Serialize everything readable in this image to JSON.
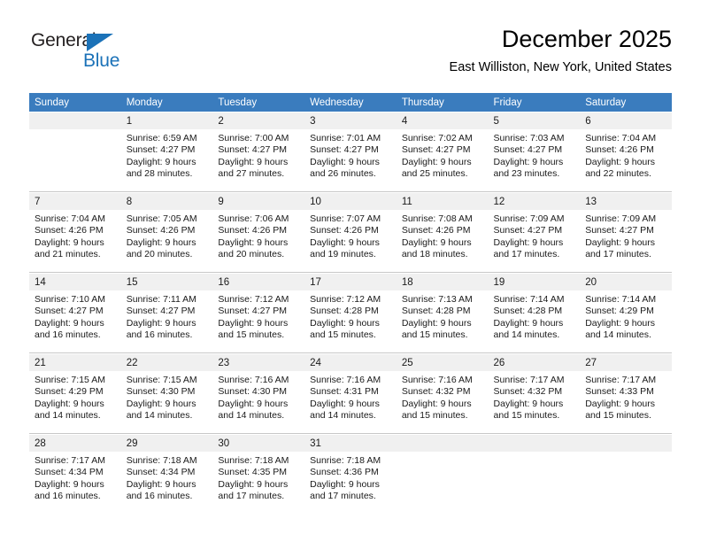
{
  "brand": {
    "name_part1": "General",
    "name_part2": "Blue",
    "triangle_icon": "triangle-icon",
    "accent_color": "#1b72b8"
  },
  "header": {
    "title": "December 2025",
    "location": "East Williston, New York, United States",
    "header_bg_color": "#3A7CBE",
    "daynum_bg_color": "#F0F0F0"
  },
  "weekday_headers": [
    "Sunday",
    "Monday",
    "Tuesday",
    "Wednesday",
    "Thursday",
    "Friday",
    "Saturday"
  ],
  "weeks": [
    [
      {
        "day": "",
        "sunrise": "",
        "sunset": "",
        "daylight_line1": "",
        "daylight_line2": "",
        "blank": true
      },
      {
        "day": "1",
        "sunrise": "Sunrise: 6:59 AM",
        "sunset": "Sunset: 4:27 PM",
        "daylight_line1": "Daylight: 9 hours",
        "daylight_line2": "and 28 minutes.",
        "blank": false
      },
      {
        "day": "2",
        "sunrise": "Sunrise: 7:00 AM",
        "sunset": "Sunset: 4:27 PM",
        "daylight_line1": "Daylight: 9 hours",
        "daylight_line2": "and 27 minutes.",
        "blank": false
      },
      {
        "day": "3",
        "sunrise": "Sunrise: 7:01 AM",
        "sunset": "Sunset: 4:27 PM",
        "daylight_line1": "Daylight: 9 hours",
        "daylight_line2": "and 26 minutes.",
        "blank": false
      },
      {
        "day": "4",
        "sunrise": "Sunrise: 7:02 AM",
        "sunset": "Sunset: 4:27 PM",
        "daylight_line1": "Daylight: 9 hours",
        "daylight_line2": "and 25 minutes.",
        "blank": false
      },
      {
        "day": "5",
        "sunrise": "Sunrise: 7:03 AM",
        "sunset": "Sunset: 4:27 PM",
        "daylight_line1": "Daylight: 9 hours",
        "daylight_line2": "and 23 minutes.",
        "blank": false
      },
      {
        "day": "6",
        "sunrise": "Sunrise: 7:04 AM",
        "sunset": "Sunset: 4:26 PM",
        "daylight_line1": "Daylight: 9 hours",
        "daylight_line2": "and 22 minutes.",
        "blank": false
      }
    ],
    [
      {
        "day": "7",
        "sunrise": "Sunrise: 7:04 AM",
        "sunset": "Sunset: 4:26 PM",
        "daylight_line1": "Daylight: 9 hours",
        "daylight_line2": "and 21 minutes.",
        "blank": false
      },
      {
        "day": "8",
        "sunrise": "Sunrise: 7:05 AM",
        "sunset": "Sunset: 4:26 PM",
        "daylight_line1": "Daylight: 9 hours",
        "daylight_line2": "and 20 minutes.",
        "blank": false
      },
      {
        "day": "9",
        "sunrise": "Sunrise: 7:06 AM",
        "sunset": "Sunset: 4:26 PM",
        "daylight_line1": "Daylight: 9 hours",
        "daylight_line2": "and 20 minutes.",
        "blank": false
      },
      {
        "day": "10",
        "sunrise": "Sunrise: 7:07 AM",
        "sunset": "Sunset: 4:26 PM",
        "daylight_line1": "Daylight: 9 hours",
        "daylight_line2": "and 19 minutes.",
        "blank": false
      },
      {
        "day": "11",
        "sunrise": "Sunrise: 7:08 AM",
        "sunset": "Sunset: 4:26 PM",
        "daylight_line1": "Daylight: 9 hours",
        "daylight_line2": "and 18 minutes.",
        "blank": false
      },
      {
        "day": "12",
        "sunrise": "Sunrise: 7:09 AM",
        "sunset": "Sunset: 4:27 PM",
        "daylight_line1": "Daylight: 9 hours",
        "daylight_line2": "and 17 minutes.",
        "blank": false
      },
      {
        "day": "13",
        "sunrise": "Sunrise: 7:09 AM",
        "sunset": "Sunset: 4:27 PM",
        "daylight_line1": "Daylight: 9 hours",
        "daylight_line2": "and 17 minutes.",
        "blank": false
      }
    ],
    [
      {
        "day": "14",
        "sunrise": "Sunrise: 7:10 AM",
        "sunset": "Sunset: 4:27 PM",
        "daylight_line1": "Daylight: 9 hours",
        "daylight_line2": "and 16 minutes.",
        "blank": false
      },
      {
        "day": "15",
        "sunrise": "Sunrise: 7:11 AM",
        "sunset": "Sunset: 4:27 PM",
        "daylight_line1": "Daylight: 9 hours",
        "daylight_line2": "and 16 minutes.",
        "blank": false
      },
      {
        "day": "16",
        "sunrise": "Sunrise: 7:12 AM",
        "sunset": "Sunset: 4:27 PM",
        "daylight_line1": "Daylight: 9 hours",
        "daylight_line2": "and 15 minutes.",
        "blank": false
      },
      {
        "day": "17",
        "sunrise": "Sunrise: 7:12 AM",
        "sunset": "Sunset: 4:28 PM",
        "daylight_line1": "Daylight: 9 hours",
        "daylight_line2": "and 15 minutes.",
        "blank": false
      },
      {
        "day": "18",
        "sunrise": "Sunrise: 7:13 AM",
        "sunset": "Sunset: 4:28 PM",
        "daylight_line1": "Daylight: 9 hours",
        "daylight_line2": "and 15 minutes.",
        "blank": false
      },
      {
        "day": "19",
        "sunrise": "Sunrise: 7:14 AM",
        "sunset": "Sunset: 4:28 PM",
        "daylight_line1": "Daylight: 9 hours",
        "daylight_line2": "and 14 minutes.",
        "blank": false
      },
      {
        "day": "20",
        "sunrise": "Sunrise: 7:14 AM",
        "sunset": "Sunset: 4:29 PM",
        "daylight_line1": "Daylight: 9 hours",
        "daylight_line2": "and 14 minutes.",
        "blank": false
      }
    ],
    [
      {
        "day": "21",
        "sunrise": "Sunrise: 7:15 AM",
        "sunset": "Sunset: 4:29 PM",
        "daylight_line1": "Daylight: 9 hours",
        "daylight_line2": "and 14 minutes.",
        "blank": false
      },
      {
        "day": "22",
        "sunrise": "Sunrise: 7:15 AM",
        "sunset": "Sunset: 4:30 PM",
        "daylight_line1": "Daylight: 9 hours",
        "daylight_line2": "and 14 minutes.",
        "blank": false
      },
      {
        "day": "23",
        "sunrise": "Sunrise: 7:16 AM",
        "sunset": "Sunset: 4:30 PM",
        "daylight_line1": "Daylight: 9 hours",
        "daylight_line2": "and 14 minutes.",
        "blank": false
      },
      {
        "day": "24",
        "sunrise": "Sunrise: 7:16 AM",
        "sunset": "Sunset: 4:31 PM",
        "daylight_line1": "Daylight: 9 hours",
        "daylight_line2": "and 14 minutes.",
        "blank": false
      },
      {
        "day": "25",
        "sunrise": "Sunrise: 7:16 AM",
        "sunset": "Sunset: 4:32 PM",
        "daylight_line1": "Daylight: 9 hours",
        "daylight_line2": "and 15 minutes.",
        "blank": false
      },
      {
        "day": "26",
        "sunrise": "Sunrise: 7:17 AM",
        "sunset": "Sunset: 4:32 PM",
        "daylight_line1": "Daylight: 9 hours",
        "daylight_line2": "and 15 minutes.",
        "blank": false
      },
      {
        "day": "27",
        "sunrise": "Sunrise: 7:17 AM",
        "sunset": "Sunset: 4:33 PM",
        "daylight_line1": "Daylight: 9 hours",
        "daylight_line2": "and 15 minutes.",
        "blank": false
      }
    ],
    [
      {
        "day": "28",
        "sunrise": "Sunrise: 7:17 AM",
        "sunset": "Sunset: 4:34 PM",
        "daylight_line1": "Daylight: 9 hours",
        "daylight_line2": "and 16 minutes.",
        "blank": false
      },
      {
        "day": "29",
        "sunrise": "Sunrise: 7:18 AM",
        "sunset": "Sunset: 4:34 PM",
        "daylight_line1": "Daylight: 9 hours",
        "daylight_line2": "and 16 minutes.",
        "blank": false
      },
      {
        "day": "30",
        "sunrise": "Sunrise: 7:18 AM",
        "sunset": "Sunset: 4:35 PM",
        "daylight_line1": "Daylight: 9 hours",
        "daylight_line2": "and 17 minutes.",
        "blank": false
      },
      {
        "day": "31",
        "sunrise": "Sunrise: 7:18 AM",
        "sunset": "Sunset: 4:36 PM",
        "daylight_line1": "Daylight: 9 hours",
        "daylight_line2": "and 17 minutes.",
        "blank": false
      },
      {
        "day": "",
        "sunrise": "",
        "sunset": "",
        "daylight_line1": "",
        "daylight_line2": "",
        "blank": true
      },
      {
        "day": "",
        "sunrise": "",
        "sunset": "",
        "daylight_line1": "",
        "daylight_line2": "",
        "blank": true
      },
      {
        "day": "",
        "sunrise": "",
        "sunset": "",
        "daylight_line1": "",
        "daylight_line2": "",
        "blank": true
      }
    ]
  ]
}
